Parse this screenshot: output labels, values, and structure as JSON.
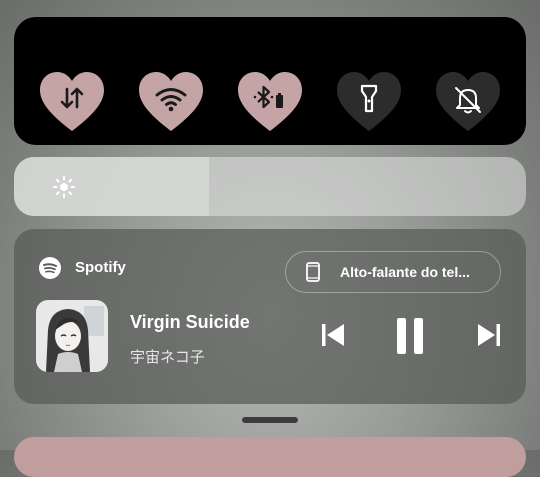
{
  "colors": {
    "tile_active": "#c4a4a4",
    "tile_inactive": "#2c2c2c",
    "panel_bg": "#000000",
    "peek_card": "#c09e9e"
  },
  "quick_settings": {
    "tiles": [
      {
        "name": "mobile-data",
        "icon": "mobile-data-icon",
        "active": true
      },
      {
        "name": "wifi",
        "icon": "wifi-icon",
        "active": true
      },
      {
        "name": "bluetooth",
        "icon": "bluetooth-icon",
        "active": true
      },
      {
        "name": "flashlight",
        "icon": "flashlight-icon",
        "active": false
      },
      {
        "name": "do-not-disturb",
        "icon": "bell-off-icon",
        "active": false
      }
    ]
  },
  "brightness": {
    "icon": "brightness-icon",
    "level": 0.38
  },
  "media": {
    "app_name": "Spotify",
    "app_icon": "spotify-icon",
    "output_device": "Alto-falante do tel...",
    "output_icon": "phone-icon",
    "track_title": "Virgin Suicide",
    "track_artist": "宇宙ネコ子",
    "controls": [
      "previous-icon",
      "pause-icon",
      "next-icon"
    ]
  }
}
